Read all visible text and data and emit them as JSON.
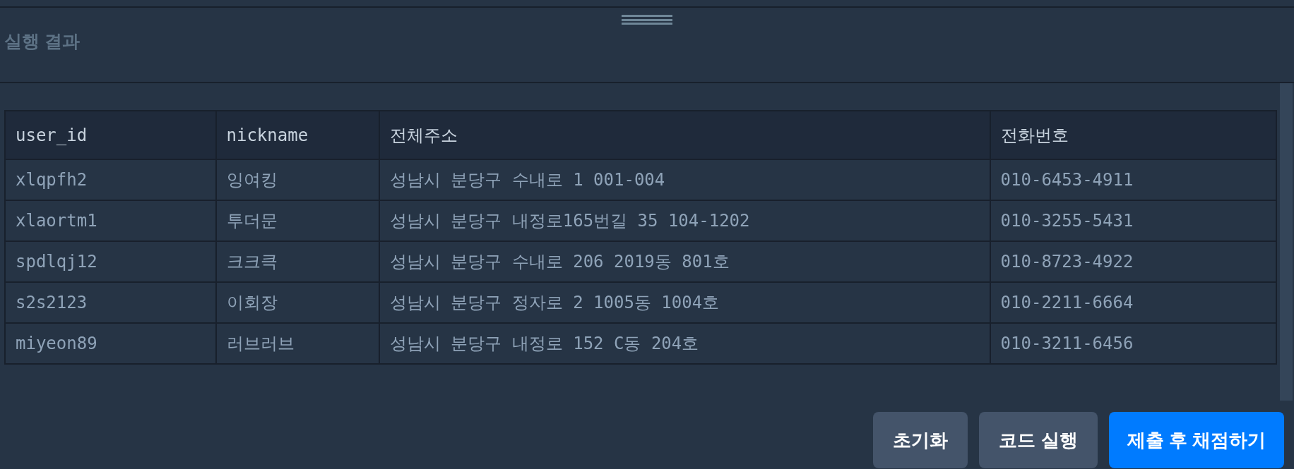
{
  "panel": {
    "title": "실행 결과"
  },
  "table": {
    "columns": [
      "user_id",
      "nickname",
      "전체주소",
      "전화번호"
    ],
    "rows": [
      [
        "xlqpfh2",
        "잉여킹",
        "성남시 분당구 수내로 1 001-004",
        "010-6453-4911"
      ],
      [
        "xlaortm1",
        "투더문",
        "성남시 분당구 내정로165번길 35 104-1202",
        "010-3255-5431"
      ],
      [
        "spdlqj12",
        "크크큭",
        "성남시 분당구 수내로 206 2019동 801호",
        "010-8723-4922"
      ],
      [
        "s2s2123",
        "이회장",
        "성남시 분당구 정자로 2 1005동 1004호",
        "010-2211-6664"
      ],
      [
        "miyeon89",
        "러브러브",
        "성남시 분당구 내정로 152 C동 204호",
        "010-3211-6456"
      ]
    ]
  },
  "buttons": [
    {
      "label": "초기화",
      "kind": "secondary"
    },
    {
      "label": "코드 실행",
      "kind": "secondary"
    },
    {
      "label": "제출 후 채점하기",
      "kind": "primary"
    }
  ]
}
